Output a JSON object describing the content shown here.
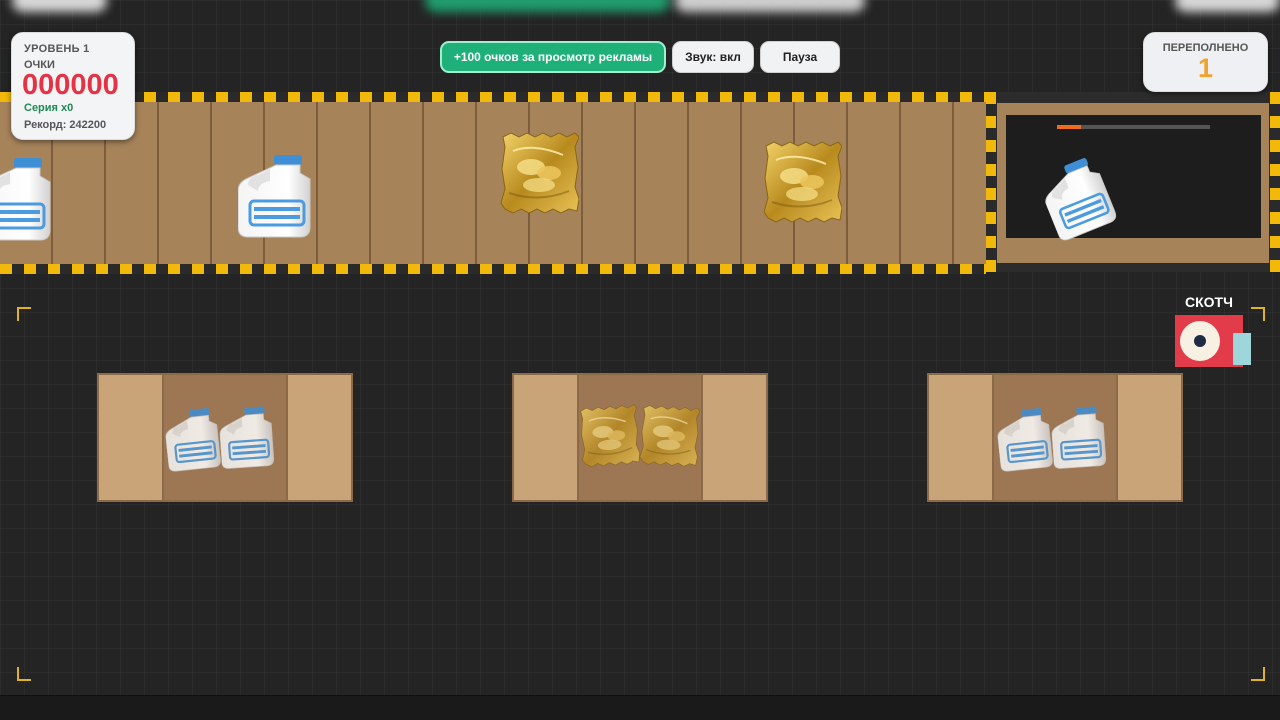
{
  "hud": {
    "level": "УРОВЕНЬ 1",
    "points_label": "ОЧКИ",
    "score": "000000",
    "streak": "Серия x0",
    "record": "Рекорд: 242200",
    "overflow_label": "ПЕРЕПОЛНЕНО",
    "overflow_count": "1"
  },
  "buttons": {
    "ad": "+100 очков за просмотр рекламы",
    "sound": "Звук: вкл",
    "pause": "Пауза"
  },
  "scanner": {
    "progress": 0.16
  },
  "tape": {
    "label": "СКОТЧ"
  },
  "conveyor_items": [
    "milk-jug",
    "milk-jug",
    "chips-bag",
    "chips-bag"
  ],
  "scanner_item": "milk-jug",
  "crates": [
    {
      "contents": "milk-jug",
      "count": 2
    },
    {
      "contents": "chips-bag",
      "count": 2
    },
    {
      "contents": "milk-jug",
      "count": 2
    }
  ],
  "colors": {
    "accent_green": "#1fb07a",
    "score_red": "#e53345",
    "overflow_orange": "#f2a22e",
    "hazard_yellow": "#f2b90a"
  }
}
